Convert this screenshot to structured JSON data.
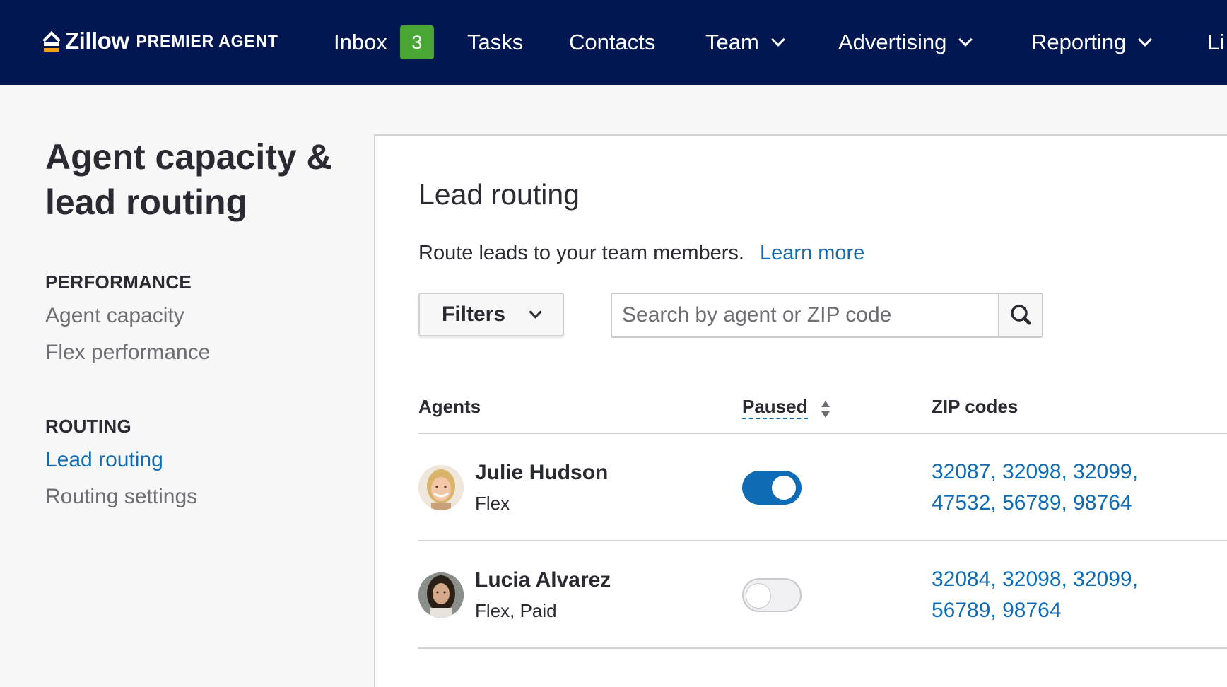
{
  "nav": {
    "logo": {
      "word": "Zillow",
      "sub": "PREMIER AGENT"
    },
    "items": [
      {
        "label": "Inbox",
        "badge": "3"
      },
      {
        "label": "Tasks"
      },
      {
        "label": "Contacts"
      },
      {
        "label": "Team",
        "dropdown": true
      },
      {
        "label": "Advertising",
        "dropdown": true
      },
      {
        "label": "Reporting",
        "dropdown": true
      },
      {
        "label": "Li"
      }
    ]
  },
  "sidebar": {
    "title": "Agent capacity & lead routing",
    "sections": [
      {
        "label": "PERFORMANCE",
        "items": [
          {
            "label": "Agent capacity"
          },
          {
            "label": "Flex performance"
          }
        ]
      },
      {
        "label": "ROUTING",
        "items": [
          {
            "label": "Lead routing",
            "active": true
          },
          {
            "label": "Routing settings"
          }
        ]
      }
    ]
  },
  "main": {
    "title": "Lead routing",
    "description": "Route leads to your team members.",
    "learn_more": "Learn more",
    "filters_label": "Filters",
    "search": {
      "placeholder": "Search by agent or ZIP code",
      "value": ""
    },
    "columns": {
      "agents": "Agents",
      "paused": "Paused",
      "zip_codes": "ZIP codes"
    },
    "rows": [
      {
        "name": "Julie Hudson",
        "type": "Flex",
        "paused": true,
        "zips_line1": "32087, 32098, 32099,",
        "zips_line2": "47532, 56789, 98764"
      },
      {
        "name": "Lucia Alvarez",
        "type": "Flex, Paid",
        "paused": false,
        "zips_line1": "32084, 32098, 32099,",
        "zips_line2": "56789, 98764"
      }
    ]
  },
  "colors": {
    "nav_bg": "#001751",
    "badge_green": "#4aa634",
    "link_blue": "#0f6bb3",
    "logo_accent": "#f6a01a"
  }
}
